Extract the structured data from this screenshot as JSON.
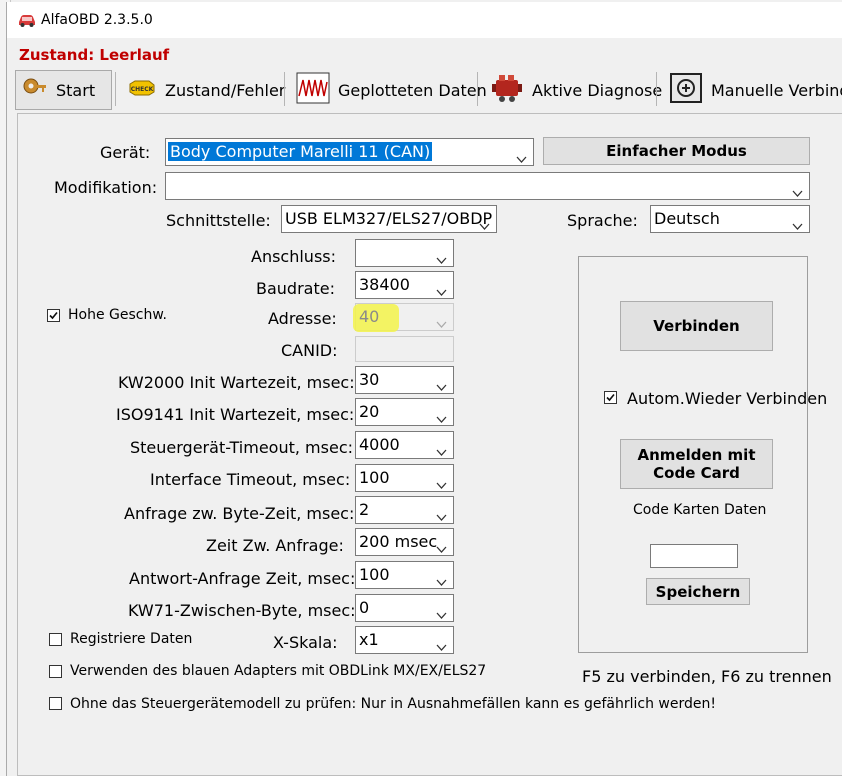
{
  "window": {
    "title": "AlfaOBD 2.3.5.0"
  },
  "status": {
    "text": "Zustand: Leerlauf",
    "color": "#c00000"
  },
  "tabs": [
    {
      "label": "Start",
      "icon": "key-icon"
    },
    {
      "label": "Zustand/Fehler",
      "icon": "check-engine-icon"
    },
    {
      "label": "Geplotteten Daten",
      "icon": "waveform-icon"
    },
    {
      "label": "Aktive Diagnose",
      "icon": "engine-icon"
    },
    {
      "label": "Manuelle Verbindu",
      "icon": "manual-connection-icon"
    }
  ],
  "form": {
    "geraet": {
      "label": "Gerät:",
      "value": "Body Computer Marelli 11 (CAN)"
    },
    "simple_mode_label": "Einfacher Modus",
    "modifikation": {
      "label": "Modifikation:",
      "value": ""
    },
    "schnittstelle": {
      "label": "Schnittstelle:",
      "value": "USB ELM327/ELS27/OBDP"
    },
    "sprache": {
      "label": "Sprache:",
      "value": "Deutsch"
    },
    "anschluss": {
      "label": "Anschluss:",
      "value": ""
    },
    "baudrate": {
      "label": "Baudrate:",
      "value": "38400"
    },
    "hohe_geschw": {
      "label": "Hohe Geschw.",
      "checked": true
    },
    "adresse": {
      "label": "Adresse:",
      "value": "40"
    },
    "canid": {
      "label": "CANID:",
      "value": ""
    },
    "kw2000": {
      "label": "KW2000 Init Wartezeit, msec:",
      "value": "30"
    },
    "iso9141": {
      "label": "ISO9141 Init Wartezeit, msec:",
      "value": "20"
    },
    "timeout": {
      "label": "Steuergerät-Timeout, msec:",
      "value": "4000"
    },
    "interface_timeout": {
      "label": "Interface Timeout, msec:",
      "value": "100"
    },
    "byte_zeit": {
      "label": "Anfrage zw. Byte-Zeit, msec:",
      "value": "2"
    },
    "zeit_anfrage": {
      "label": "Zeit Zw. Anfrage:",
      "value": "200 msec"
    },
    "antwort_zeit": {
      "label": "Antwort-Anfrage Zeit, msec:",
      "value": "100"
    },
    "kw71": {
      "label": "KW71-Zwischen-Byte, msec:",
      "value": "0"
    },
    "registriere": {
      "label": "Registriere Daten",
      "checked": false
    },
    "x_skala": {
      "label": "X-Skala:",
      "value": "x1"
    },
    "blue_adapter": {
      "label": "Verwenden des blauen Adapters mit OBDLink MX/EX/ELS27",
      "checked": false
    },
    "no_check": {
      "label": "Ohne das Steuergerätemodell zu prüfen: Nur in Ausnahmefällen kann es gefährlich werden!",
      "checked": false
    }
  },
  "connect_panel": {
    "connect_label": "Verbinden",
    "auto_reconnect": {
      "label": "Autom.Wieder Verbinden",
      "checked": true
    },
    "code_card_label_line1": "Anmelden mit",
    "code_card_label_line2": "Code Card",
    "code_data_label": "Code Karten Daten",
    "code_input_value": "",
    "save_label": "Speichern"
  },
  "hint": "F5 zu verbinden, F6 zu trennen",
  "colors": {
    "highlight": "#f3f34a",
    "status_red": "#c00000",
    "selection_blue": "#0078d7"
  }
}
